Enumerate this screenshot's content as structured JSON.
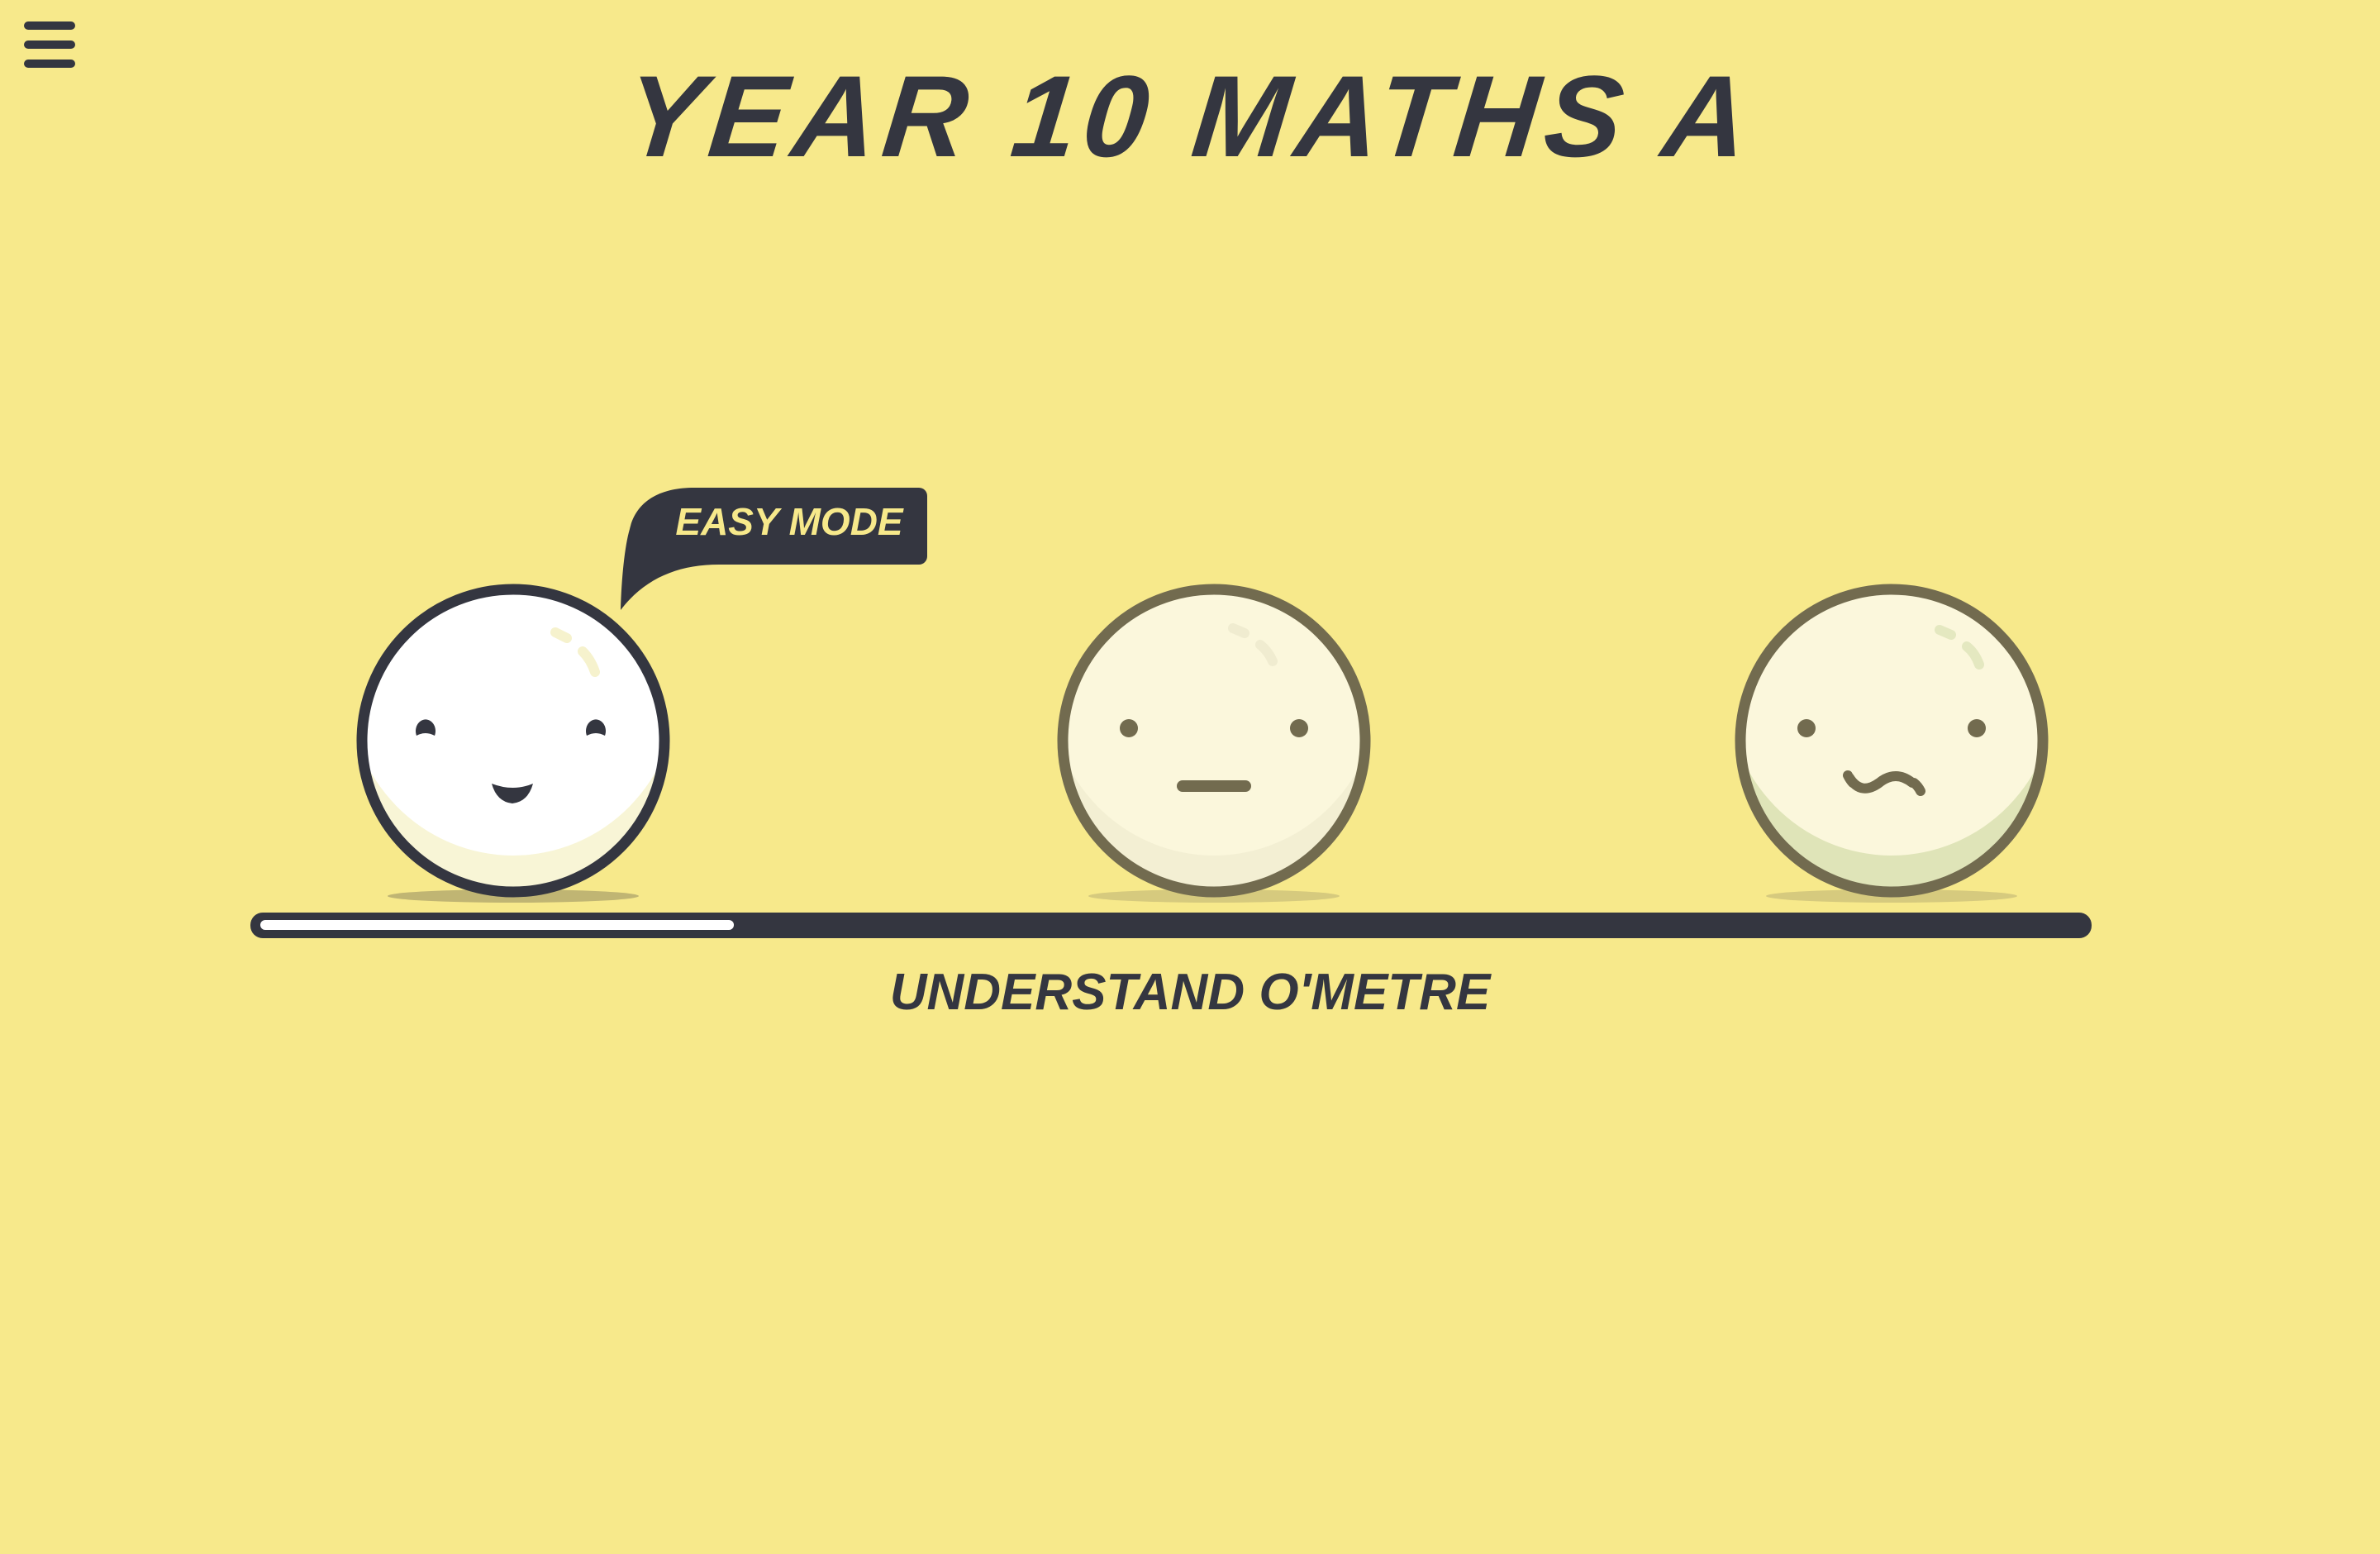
{
  "header": {
    "title": "Year 10 Maths A",
    "menu_icon": "hamburger-icon"
  },
  "bubble": {
    "text": "Easy Mode"
  },
  "faces": [
    {
      "mood": "happy",
      "selected": true
    },
    {
      "mood": "neutral",
      "selected": false
    },
    {
      "mood": "worried",
      "selected": false
    }
  ],
  "meter": {
    "label": "Understand O'Metre",
    "progress": 0.26
  },
  "colors": {
    "background": "#f7e98b",
    "dark": "#343640",
    "faded_border": "#726b4f"
  }
}
